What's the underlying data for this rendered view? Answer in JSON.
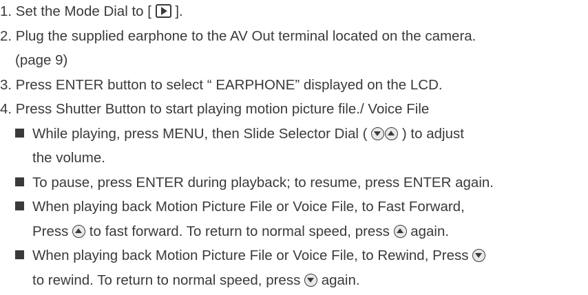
{
  "steps": [
    {
      "number": "1.",
      "before": " Set the Mode Dial to [ ",
      "icon": "play-icon",
      "after": " ]."
    },
    {
      "number": "2.",
      "text": " Plug the supplied earphone to the AV Out terminal located on the camera.",
      "continuation": "(page 9)"
    },
    {
      "number": "3.",
      "text": " Press ENTER button to select “ EARPHONE” displayed on the LCD."
    },
    {
      "number": "4.",
      "text": " Press Shutter Button to start playing motion picture file./ Voice File"
    }
  ],
  "bullets": [
    {
      "part1": "While playing, press MENU, then Slide Selector Dial ( ",
      "part2": " ) to adjust",
      "continuation": "the volume."
    },
    {
      "text": "To pause, press ENTER during playback; to resume, press ENTER again."
    },
    {
      "line1": "When playing back Motion Picture File or Voice File, to Fast Forward,",
      "part1": "Press ",
      "part2": " to fast forward. To return to normal speed, press ",
      "part3": " again."
    },
    {
      "line1_text": "When playing back Motion Picture File or Voice File, to Rewind, Press ",
      "part1": "to rewind. To return to normal speed, press ",
      "part2": " again."
    }
  ],
  "icons": {
    "play": "play-icon",
    "up": "up-arrow-icon",
    "down": "down-arrow-icon"
  },
  "colors": {
    "text": "#3a3a3a",
    "background": "#ffffff"
  }
}
